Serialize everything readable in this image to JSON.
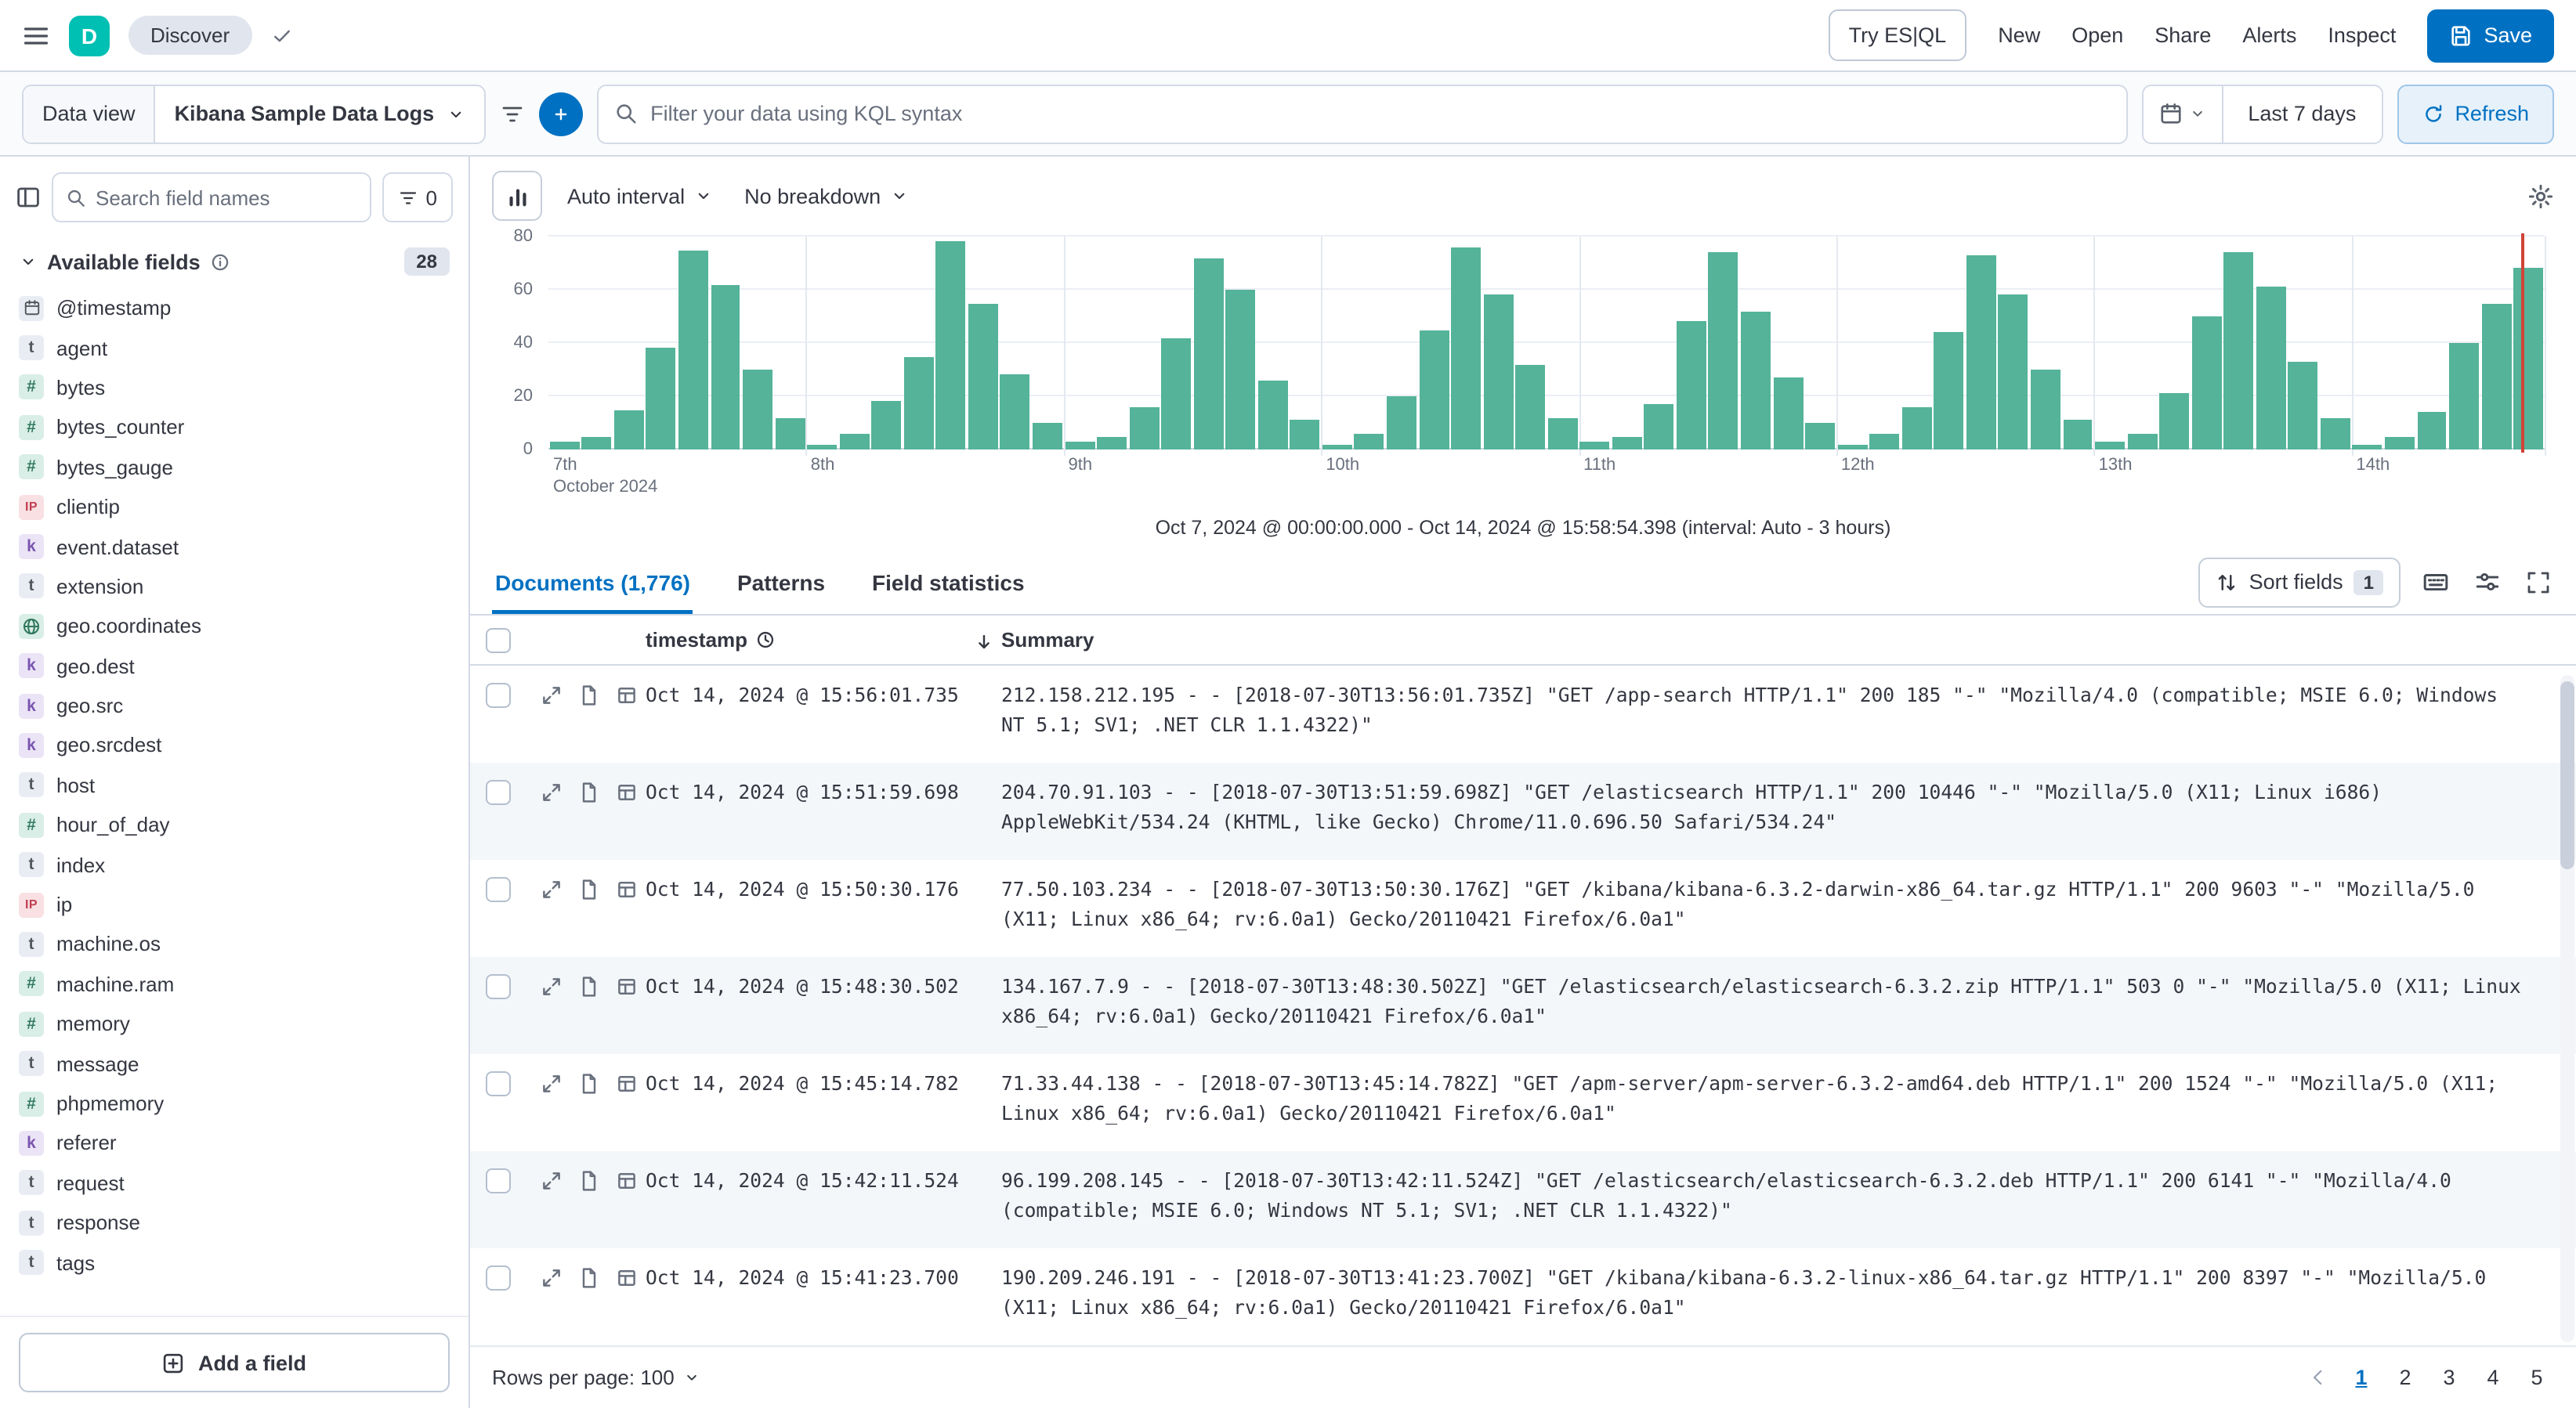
{
  "topbar": {
    "logo_letter": "D",
    "breadcrumb": "Discover",
    "try_esql_label": "Try ES|QL",
    "nav_links": [
      "New",
      "Open",
      "Share",
      "Alerts",
      "Inspect"
    ],
    "save_label": "Save"
  },
  "querybar": {
    "data_view_label": "Data view",
    "data_view_value": "Kibana Sample Data Logs",
    "kql_placeholder": "Filter your data using KQL syntax",
    "time_range": "Last 7 days",
    "refresh_label": "Refresh"
  },
  "sidebar": {
    "search_placeholder": "Search field names",
    "field_filter_count": "0",
    "section_title": "Available fields",
    "section_count": "28",
    "add_field_label": "Add a field",
    "fields": [
      {
        "name": "@timestamp",
        "type": "date"
      },
      {
        "name": "agent",
        "type": "text"
      },
      {
        "name": "bytes",
        "type": "number"
      },
      {
        "name": "bytes_counter",
        "type": "number"
      },
      {
        "name": "bytes_gauge",
        "type": "number"
      },
      {
        "name": "clientip",
        "type": "ip"
      },
      {
        "name": "event.dataset",
        "type": "keyword"
      },
      {
        "name": "extension",
        "type": "text"
      },
      {
        "name": "geo.coordinates",
        "type": "geo"
      },
      {
        "name": "geo.dest",
        "type": "keyword"
      },
      {
        "name": "geo.src",
        "type": "keyword"
      },
      {
        "name": "geo.srcdest",
        "type": "keyword"
      },
      {
        "name": "host",
        "type": "text"
      },
      {
        "name": "hour_of_day",
        "type": "number"
      },
      {
        "name": "index",
        "type": "text"
      },
      {
        "name": "ip",
        "type": "ip"
      },
      {
        "name": "machine.os",
        "type": "text"
      },
      {
        "name": "machine.ram",
        "type": "number"
      },
      {
        "name": "memory",
        "type": "number"
      },
      {
        "name": "message",
        "type": "text"
      },
      {
        "name": "phpmemory",
        "type": "number"
      },
      {
        "name": "referer",
        "type": "keyword"
      },
      {
        "name": "request",
        "type": "text"
      },
      {
        "name": "response",
        "type": "text"
      },
      {
        "name": "tags",
        "type": "text"
      }
    ]
  },
  "histogram_controls": {
    "interval_label": "Auto interval",
    "breakdown_label": "No breakdown"
  },
  "chart_data": {
    "type": "bar",
    "caption": "Oct 7, 2024 @ 00:00:00.000 - Oct 14, 2024 @ 15:58:54.398 (interval: Auto - 3 hours)",
    "start": "Oct 7, 2024 @ 00:00:00.000",
    "end": "Oct 14, 2024 @ 15:58:54.398",
    "bucket_interval": "3h",
    "ylim": [
      0,
      80
    ],
    "y_ticks": [
      0,
      20,
      40,
      60,
      80
    ],
    "x_day_labels": [
      "7th",
      "8th",
      "9th",
      "10th",
      "11th",
      "12th",
      "13th",
      "14th"
    ],
    "x_month_label": "October 2024",
    "bars_per_day": 8,
    "values": [
      3,
      5,
      15,
      38,
      75,
      62,
      30,
      12,
      2,
      6,
      18,
      35,
      78,
      55,
      28,
      10,
      3,
      5,
      16,
      42,
      72,
      60,
      26,
      11,
      2,
      6,
      20,
      45,
      76,
      58,
      32,
      12,
      3,
      5,
      17,
      48,
      74,
      52,
      27,
      10,
      2,
      6,
      16,
      44,
      73,
      58,
      30,
      11,
      3,
      6,
      21,
      50,
      74,
      61,
      33,
      12,
      2,
      5,
      14,
      40,
      55,
      68
    ],
    "bar_color": "#54B399",
    "current_time_marker_pct": 98.8,
    "marker_color": "#D04437",
    "grid": true,
    "legend": "none"
  },
  "tabs": [
    {
      "label": "Documents (1,776)",
      "active": true
    },
    {
      "label": "Patterns",
      "active": false
    },
    {
      "label": "Field statistics",
      "active": false
    }
  ],
  "grid_toolbar": {
    "sort_fields_label": "Sort fields",
    "sort_fields_count": "1"
  },
  "table": {
    "header": {
      "timestamp": "timestamp",
      "summary": "Summary"
    },
    "rows": [
      {
        "timestamp": "Oct 14, 2024 @ 15:56:01.735",
        "summary": "212.158.212.195 - - [2018-07-30T13:56:01.735Z] \"GET /app-search HTTP/1.1\" 200 185 \"-\" \"Mozilla/4.0 (compatible; MSIE 6.0; Windows NT 5.1; SV1; .NET CLR 1.1.4322)\""
      },
      {
        "timestamp": "Oct 14, 2024 @ 15:51:59.698",
        "summary": "204.70.91.103 - - [2018-07-30T13:51:59.698Z] \"GET /elasticsearch HTTP/1.1\" 200 10446 \"-\" \"Mozilla/5.0 (X11; Linux i686) AppleWebKit/534.24 (KHTML, like Gecko) Chrome/11.0.696.50 Safari/534.24\""
      },
      {
        "timestamp": "Oct 14, 2024 @ 15:50:30.176",
        "summary": "77.50.103.234 - - [2018-07-30T13:50:30.176Z] \"GET /kibana/kibana-6.3.2-darwin-x86_64.tar.gz HTTP/1.1\" 200 9603 \"-\" \"Mozilla/5.0 (X11; Linux x86_64; rv:6.0a1) Gecko/20110421 Firefox/6.0a1\""
      },
      {
        "timestamp": "Oct 14, 2024 @ 15:48:30.502",
        "summary": "134.167.7.9 - - [2018-07-30T13:48:30.502Z] \"GET /elasticsearch/elasticsearch-6.3.2.zip HTTP/1.1\" 503 0 \"-\" \"Mozilla/5.0 (X11; Linux x86_64; rv:6.0a1) Gecko/20110421 Firefox/6.0a1\""
      },
      {
        "timestamp": "Oct 14, 2024 @ 15:45:14.782",
        "summary": "71.33.44.138 - - [2018-07-30T13:45:14.782Z] \"GET /apm-server/apm-server-6.3.2-amd64.deb HTTP/1.1\" 200 1524 \"-\" \"Mozilla/5.0 (X11; Linux x86_64; rv:6.0a1) Gecko/20110421 Firefox/6.0a1\""
      },
      {
        "timestamp": "Oct 14, 2024 @ 15:42:11.524",
        "summary": "96.199.208.145 - - [2018-07-30T13:42:11.524Z] \"GET /elasticsearch/elasticsearch-6.3.2.deb HTTP/1.1\" 200 6141 \"-\" \"Mozilla/4.0 (compatible; MSIE 6.0; Windows NT 5.1; SV1; .NET CLR 1.1.4322)\""
      },
      {
        "timestamp": "Oct 14, 2024 @ 15:41:23.700",
        "summary": "190.209.246.191 - - [2018-07-30T13:41:23.700Z] \"GET /kibana/kibana-6.3.2-linux-x86_64.tar.gz HTTP/1.1\" 200 8397 \"-\" \"Mozilla/5.0 (X11; Linux x86_64; rv:6.0a1) Gecko/20110421 Firefox/6.0a1\""
      }
    ]
  },
  "footer": {
    "rows_per_page_label": "Rows per page: 100",
    "pages": [
      "1",
      "2",
      "3",
      "4",
      "5"
    ],
    "active_page": "1"
  },
  "colors": {
    "primary": "#0071C2",
    "bar": "#54B399",
    "logo_green": "#00BFB3"
  }
}
